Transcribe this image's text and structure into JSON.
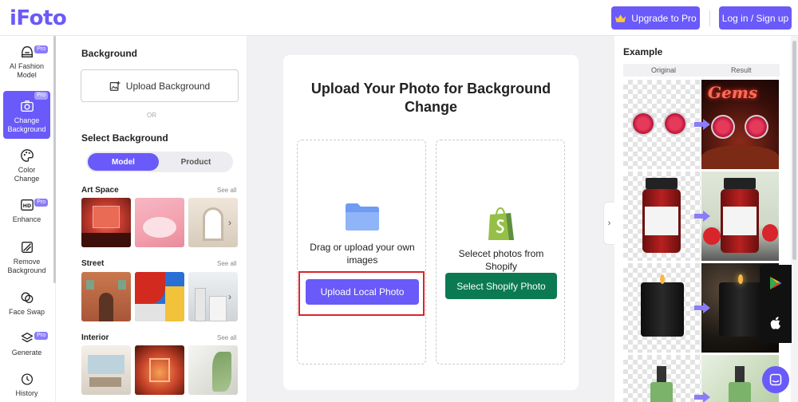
{
  "app": {
    "logo": "iFoto"
  },
  "header": {
    "upgrade_label": "Upgrade to Pro",
    "login_label": "Log in / Sign up"
  },
  "nav": {
    "items": [
      {
        "label_1": "AI Fashion",
        "label_2": "Model",
        "pro": "Pro"
      },
      {
        "label_1": "Change",
        "label_2": "Background",
        "pro": "Pro"
      },
      {
        "label_1": "Color",
        "label_2": "Change"
      },
      {
        "label_1": "Enhance",
        "pro": "Pro"
      },
      {
        "label_1": "Remove",
        "label_2": "Background"
      },
      {
        "label_1": "Face Swap"
      },
      {
        "label_1": "Generate",
        "pro": "Pro"
      },
      {
        "label_1": "History"
      }
    ]
  },
  "panel": {
    "title": "Background",
    "upload_label": "Upload Background",
    "or": "OR",
    "select_title": "Select Background",
    "tabs": {
      "model": "Model",
      "product": "Product"
    },
    "categories": [
      {
        "title": "Art Space",
        "see_all": "See all"
      },
      {
        "title": "Street",
        "see_all": "See all"
      },
      {
        "title": "Interior",
        "see_all": "See all"
      }
    ]
  },
  "main": {
    "title": "Upload Your Photo for Background Change",
    "local_text": "Drag or upload your own images",
    "local_button": "Upload Local Photo",
    "shopify_text": "Selecet photos from Shopify",
    "shopify_button": "Select Shopify Photo"
  },
  "example": {
    "title": "Example",
    "col_original": "Original",
    "col_result": "Result"
  },
  "colors": {
    "accent": "#6a5af9",
    "shopify_green": "#0b7a52",
    "highlight": "#d9262c"
  }
}
